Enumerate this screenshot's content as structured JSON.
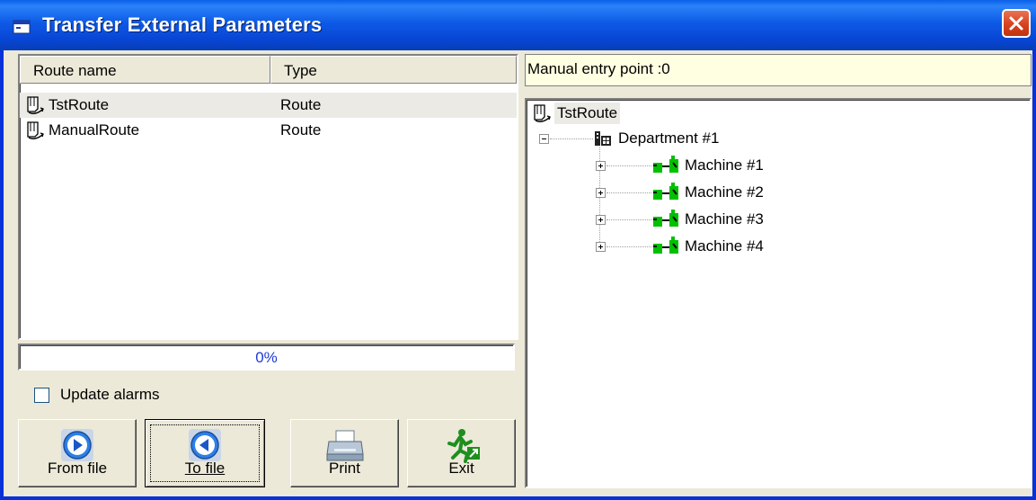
{
  "window": {
    "title": "Transfer External Parameters"
  },
  "route_list": {
    "columns": [
      "Route name",
      "Type"
    ],
    "rows": [
      {
        "name": "TstRoute",
        "type": "Route",
        "selected": true
      },
      {
        "name": "ManualRoute",
        "type": "Route",
        "selected": false
      }
    ]
  },
  "progress": {
    "text": "0%",
    "value": 0
  },
  "update_alarms": {
    "label": "Update alarms",
    "checked": false
  },
  "buttons": {
    "from_file": "From file",
    "to_file": "To file",
    "print": "Print",
    "exit": "Exit"
  },
  "entry_point": {
    "text": "Manual entry point :0"
  },
  "tree": {
    "root": "TstRoute",
    "department": "Department #1",
    "machines": [
      "Machine #1",
      "Machine #2",
      "Machine #3",
      "Machine #4"
    ]
  },
  "colors": {
    "title_bar": "#0a5fe8",
    "entry_bar_bg": "#ffffe1",
    "progress_text": "#1c3bd6",
    "machine_icon": "#00c000"
  }
}
